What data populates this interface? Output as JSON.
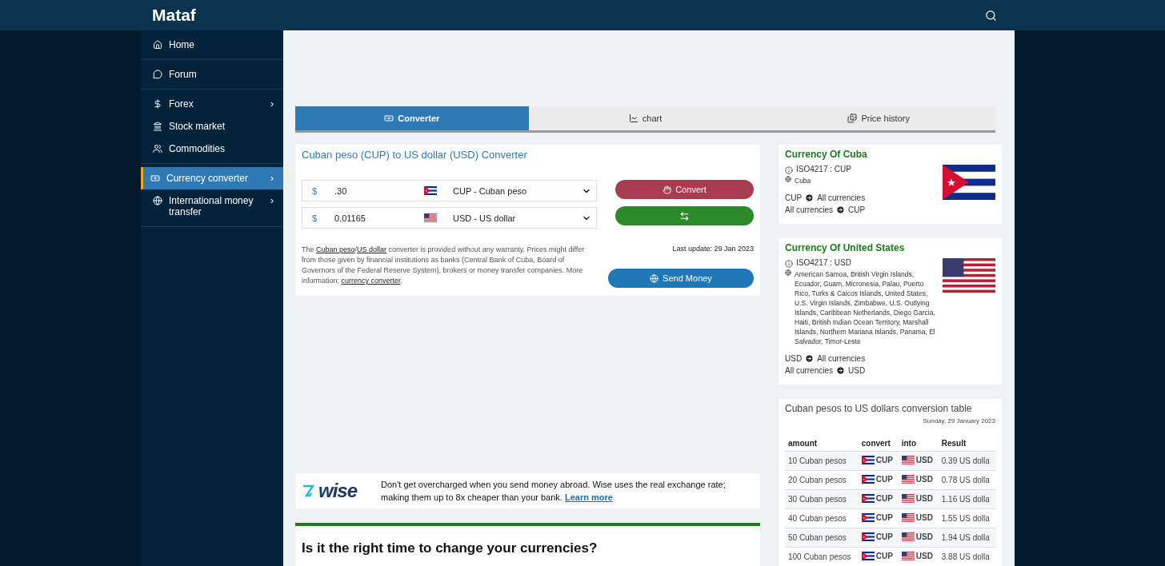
{
  "header": {
    "logo": "Mataf"
  },
  "sidebar": {
    "groups": [
      [
        {
          "label": "Home",
          "selected": false,
          "expandable": false
        }
      ],
      [
        {
          "label": "Forum",
          "selected": false,
          "expandable": false
        }
      ],
      [
        {
          "label": "Forex",
          "selected": false,
          "expandable": true
        },
        {
          "label": "Stock market",
          "selected": false,
          "expandable": false
        },
        {
          "label": "Commodities",
          "selected": false,
          "expandable": false
        }
      ],
      [
        {
          "label": "Currency converter",
          "selected": true,
          "expandable": true
        },
        {
          "label": "International money transfer",
          "selected": false,
          "expandable": true
        }
      ]
    ],
    "arrow": "›"
  },
  "tabs": [
    {
      "label": "Converter",
      "selected": true
    },
    {
      "label": "chart",
      "selected": false
    },
    {
      "label": "Price history",
      "selected": false
    }
  ],
  "converter": {
    "title": "Cuban peso (CUP) to US dollar (USD) Converter",
    "rows": [
      {
        "symbol": "$",
        "amount": ".30",
        "currency": "CUP - Cuban peso"
      },
      {
        "symbol": "$",
        "amount": "0.01165",
        "currency": "USD - US dollar"
      }
    ],
    "convert_button": "Convert",
    "send_button": "Send Money",
    "last_update": "Last update: 29 Jan 2023",
    "disclaimer": {
      "before": "The ",
      "link1": "Cuban peso",
      "slash": "/",
      "link2": "US dollar",
      "middle": " converter is provided without any warranty. Prices might differ from those given by financial institutions as banks (Central Bank of Cuba, Board of Governors of the Federal Reserve System), brokers or money transfer companies. More information: ",
      "link3": "currency converter",
      "after": "."
    }
  },
  "wise": {
    "logo": "wise",
    "text": "Don't get overcharged when you send money abroad. Wise uses the real exchange rate; making them up to 8x cheaper than your bank. ",
    "link": "Learn more"
  },
  "section_heading": "Is it the right time to change your currencies?",
  "currencies": [
    {
      "title": "Currency Of Cuba",
      "iso": "ISO4217 : CUP",
      "countries": "Cuba",
      "link1": {
        "from": "CUP",
        "to": "All currencies"
      },
      "link2": {
        "from": "All currencies",
        "to": "CUP"
      }
    },
    {
      "title": "Currency Of United States",
      "iso": "ISO4217 : USD",
      "countries": "American Samoa, British Virgin Islands, Ecuador, Guam, Micronesia, Palau, Puerto Rico, Turks & Caicos Islands, United States, U.S. Virgin Islands, Zimbabwe, U.S. Outlying Islands, Caribbean Netherlands, Diego Garcia, Haiti, British Indian Ocean Territory, Marshall Islands, Northern Mariana Islands, Panama, El Salvador, Timor-Leste",
      "link1": {
        "from": "USD",
        "to": "All currencies"
      },
      "link2": {
        "from": "All currencies",
        "to": "USD"
      }
    }
  ],
  "table": {
    "title": "Cuban pesos to US dollars conversion table",
    "date": "Sunday, 29 January 2023",
    "columns": [
      "amount",
      "convert",
      "into",
      "Result"
    ],
    "rows": [
      {
        "amount": "10 Cuban pesos",
        "convert": "CUP",
        "into": "USD",
        "result": "0.39 US dolla"
      },
      {
        "amount": "20 Cuban pesos",
        "convert": "CUP",
        "into": "USD",
        "result": "0.78 US dolla"
      },
      {
        "amount": "30 Cuban pesos",
        "convert": "CUP",
        "into": "USD",
        "result": "1.16 US dolla"
      },
      {
        "amount": "40 Cuban pesos",
        "convert": "CUP",
        "into": "USD",
        "result": "1.55 US dolla"
      },
      {
        "amount": "50 Cuban pesos",
        "convert": "CUP",
        "into": "USD",
        "result": "1.94 US dolla"
      },
      {
        "amount": "100 Cuban pesos",
        "convert": "CUP",
        "into": "USD",
        "result": "3.88 US dolla"
      }
    ]
  }
}
